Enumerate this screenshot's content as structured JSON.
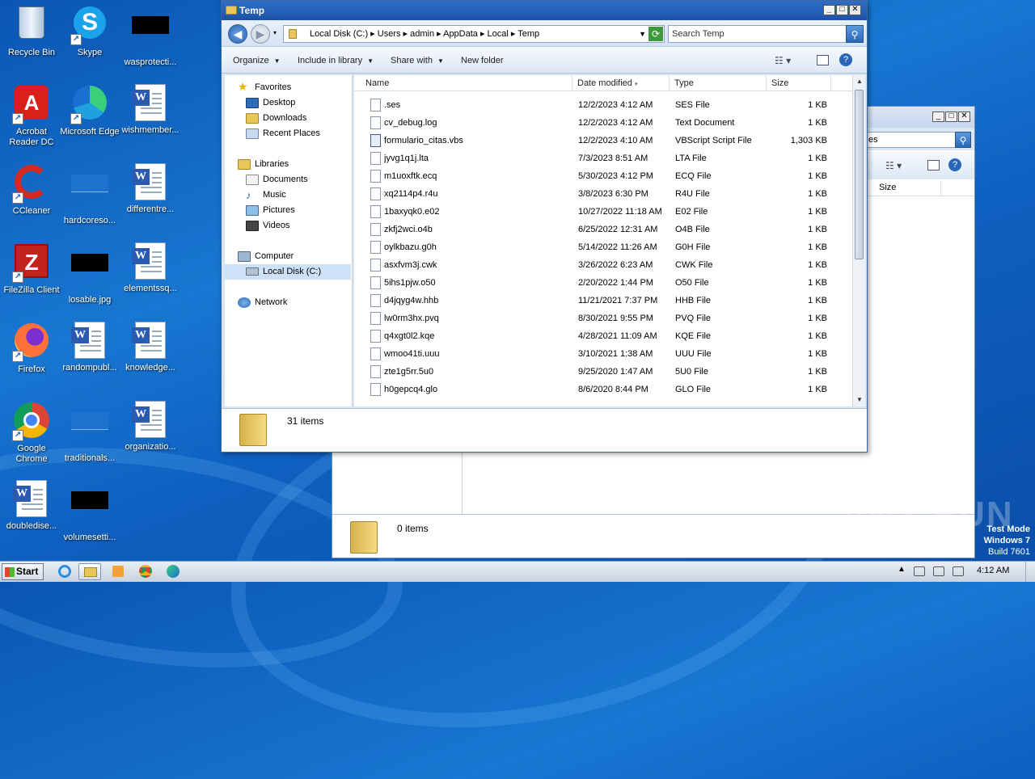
{
  "desktop": {
    "icons": [
      {
        "label": "Recycle Bin"
      },
      {
        "label": "Skype"
      },
      {
        "label": "wasprotecti..."
      },
      {
        "label": "Acrobat Reader DC"
      },
      {
        "label": "Microsoft Edge"
      },
      {
        "label": "wishmember..."
      },
      {
        "label": "CCleaner"
      },
      {
        "label": "hardcoreso..."
      },
      {
        "label": "differentre..."
      },
      {
        "label": "FileZilla Client"
      },
      {
        "label": "losable.jpg"
      },
      {
        "label": "elementssq..."
      },
      {
        "label": "Firefox"
      },
      {
        "label": "randompubl..."
      },
      {
        "label": "knowledge..."
      },
      {
        "label": "Google Chrome"
      },
      {
        "label": "traditionals..."
      },
      {
        "label": "organizatio..."
      },
      {
        "label": "doubledise..."
      },
      {
        "label": "volumesetti..."
      }
    ]
  },
  "window": {
    "title": "Temp",
    "breadcrumb": [
      "Local Disk (C:)",
      "Users",
      "admin",
      "AppData",
      "Local",
      "Temp"
    ],
    "breadcrumb_text": "Local Disk (C:)  ▸  Users  ▸  admin  ▸  AppData  ▸  Local  ▸  Temp",
    "search_placeholder": "Search Temp",
    "toolbar": {
      "organize": "Organize",
      "include_in_library": "Include in library",
      "share_with": "Share with",
      "new_folder": "New folder"
    },
    "nav": {
      "favorites": "Favorites",
      "desktop": "Desktop",
      "downloads": "Downloads",
      "recent_places": "Recent Places",
      "libraries": "Libraries",
      "documents": "Documents",
      "music": "Music",
      "pictures": "Pictures",
      "videos": "Videos",
      "computer": "Computer",
      "local_disk": "Local Disk (C:)",
      "network": "Network"
    },
    "columns": {
      "name": "Name",
      "date_modified": "Date modified",
      "type": "Type",
      "size": "Size"
    },
    "files": [
      {
        "name": ".ses",
        "date": "12/2/2023 4:12 AM",
        "type": "SES File",
        "size": "1 KB"
      },
      {
        "name": "cv_debug.log",
        "date": "12/2/2023 4:12 AM",
        "type": "Text Document",
        "size": "1 KB"
      },
      {
        "name": "formulario_citas.vbs",
        "date": "12/2/2023 4:10 AM",
        "type": "VBScript Script File",
        "size": "1,303 KB"
      },
      {
        "name": "jyvg1q1j.lta",
        "date": "7/3/2023 8:51 AM",
        "type": "LTA File",
        "size": "1 KB"
      },
      {
        "name": "m1uoxftk.ecq",
        "date": "5/30/2023 4:12 PM",
        "type": "ECQ File",
        "size": "1 KB"
      },
      {
        "name": "xq2114p4.r4u",
        "date": "3/8/2023 6:30 PM",
        "type": "R4U File",
        "size": "1 KB"
      },
      {
        "name": "1baxyqk0.e02",
        "date": "10/27/2022 11:18 AM",
        "type": "E02 File",
        "size": "1 KB"
      },
      {
        "name": "zkfj2wci.o4b",
        "date": "6/25/2022 12:31 AM",
        "type": "O4B File",
        "size": "1 KB"
      },
      {
        "name": "oylkbazu.g0h",
        "date": "5/14/2022 11:26 AM",
        "type": "G0H File",
        "size": "1 KB"
      },
      {
        "name": "asxfvm3j.cwk",
        "date": "3/26/2022 6:23 AM",
        "type": "CWK File",
        "size": "1 KB"
      },
      {
        "name": "5ihs1pjw.o50",
        "date": "2/20/2022 1:44 PM",
        "type": "O50 File",
        "size": "1 KB"
      },
      {
        "name": "d4jqyg4w.hhb",
        "date": "11/21/2021 7:37 PM",
        "type": "HHB File",
        "size": "1 KB"
      },
      {
        "name": "lw0rm3hx.pvq",
        "date": "8/30/2021 9:55 PM",
        "type": "PVQ File",
        "size": "1 KB"
      },
      {
        "name": "q4xgt0l2.kqe",
        "date": "4/28/2021 11:09 AM",
        "type": "KQE File",
        "size": "1 KB"
      },
      {
        "name": "wmoo41ti.uuu",
        "date": "3/10/2021 1:38 AM",
        "type": "UUU File",
        "size": "1 KB"
      },
      {
        "name": "zte1g5rr.5u0",
        "date": "9/25/2020 1:47 AM",
        "type": "5U0 File",
        "size": "1 KB"
      },
      {
        "name": "h0gepcq4.glo",
        "date": "8/6/2020 8:44 PM",
        "type": "GLO File",
        "size": "1 KB"
      }
    ],
    "status_items": "31 items"
  },
  "back_window": {
    "search_text": "es",
    "column_size": "Size",
    "status_items": "0 items"
  },
  "taskbar": {
    "start": "Start",
    "clock": "4:12 AM"
  },
  "watermark": {
    "text": "ANY RUN",
    "test_mode": "Test Mode",
    "os": "Windows 7",
    "build": "Build 7601"
  }
}
